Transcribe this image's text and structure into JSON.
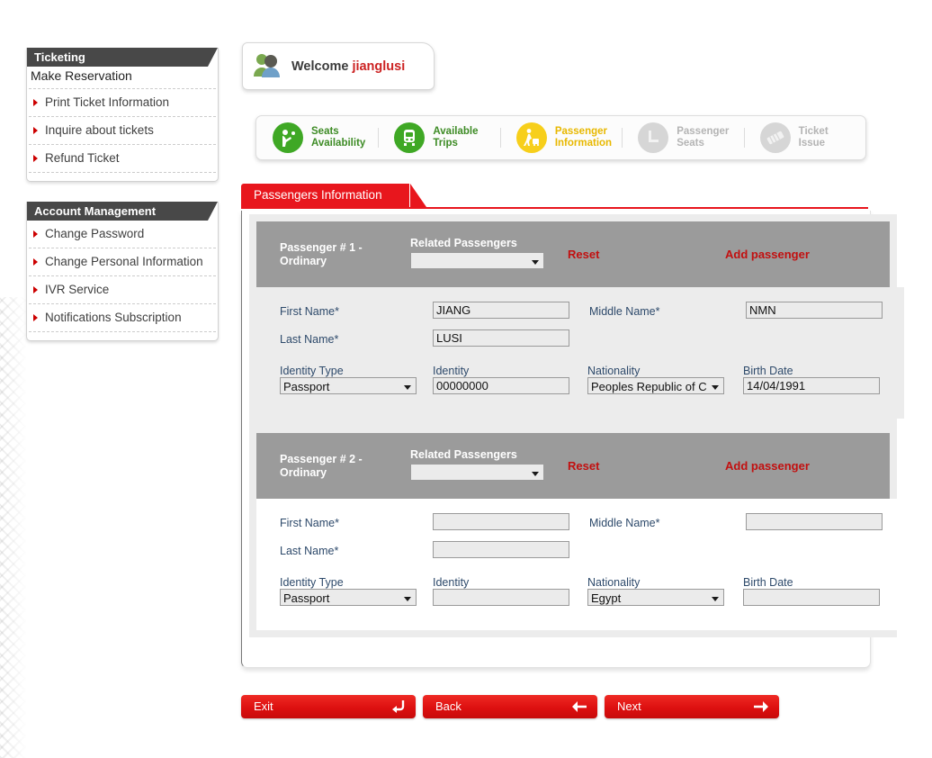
{
  "sidebar": {
    "panels": [
      {
        "title": "Ticketing",
        "items": [
          {
            "label": "Make Reservation",
            "bullet": false
          },
          {
            "label": "Print Ticket Information",
            "bullet": true
          },
          {
            "label": "Inquire about tickets",
            "bullet": true
          },
          {
            "label": "Refund Ticket",
            "bullet": true
          }
        ]
      },
      {
        "title": "Account Management",
        "items": [
          {
            "label": "Change Password",
            "bullet": true
          },
          {
            "label": "Change Personal Information",
            "bullet": true
          },
          {
            "label": "IVR Service",
            "bullet": true
          },
          {
            "label": "Notifications Subscription",
            "bullet": true
          }
        ]
      }
    ]
  },
  "welcome": {
    "greeting": "Welcome",
    "username": "jianglusi",
    "avatar_icon": "users-avatar-icon"
  },
  "wizard": {
    "steps": [
      {
        "line1": "Seats",
        "line2": "Availability",
        "state": "done",
        "icon": "seat-person-icon"
      },
      {
        "line1": "Available",
        "line2": "Trips",
        "state": "done",
        "icon": "train-icon"
      },
      {
        "line1": "Passenger",
        "line2": "Information",
        "state": "active",
        "icon": "passenger-luggage-icon"
      },
      {
        "line1": "Passenger",
        "line2": "Seats",
        "state": "todo",
        "icon": "seat-icon"
      },
      {
        "line1": "Ticket",
        "line2": "Issue",
        "state": "todo",
        "icon": "ticket-icon"
      }
    ],
    "colors": {
      "done": "#3fa825",
      "active": "#f7cf1b",
      "todo": "#d6d6d6"
    }
  },
  "tab": {
    "label": "Passengers Information",
    "color": "#e8161d"
  },
  "labels": {
    "related_passengers": "Related Passengers",
    "reset": "Reset",
    "add_passenger": "Add passenger",
    "first_name": "First Name",
    "middle_name": "Middle Name",
    "last_name": "Last Name",
    "identity_type": "Identity Type",
    "identity": "Identity",
    "nationality": "Nationality",
    "birth_date": "Birth Date",
    "required_mark": "*"
  },
  "passengers": [
    {
      "title_line1": "Passenger # 1 -",
      "title_line2": "Ordinary",
      "related_value": "",
      "first_name": "JIANG",
      "middle_name": "NMN",
      "last_name": "LUSI",
      "identity_type": "Passport",
      "identity": "00000000",
      "nationality": "Peoples Republic of C",
      "birth_date": "14/04/1991"
    },
    {
      "title_line1": "Passenger # 2 -",
      "title_line2": "Ordinary",
      "related_value": "",
      "first_name": "",
      "middle_name": "",
      "last_name": "",
      "identity_type": "Passport",
      "identity": "",
      "nationality": "Egypt",
      "birth_date": ""
    }
  ],
  "actions": [
    {
      "label": "Exit",
      "icon": "return-arrow-icon"
    },
    {
      "label": "Back",
      "icon": "arrow-left-icon"
    },
    {
      "label": "Next",
      "icon": "arrow-right-icon"
    }
  ]
}
